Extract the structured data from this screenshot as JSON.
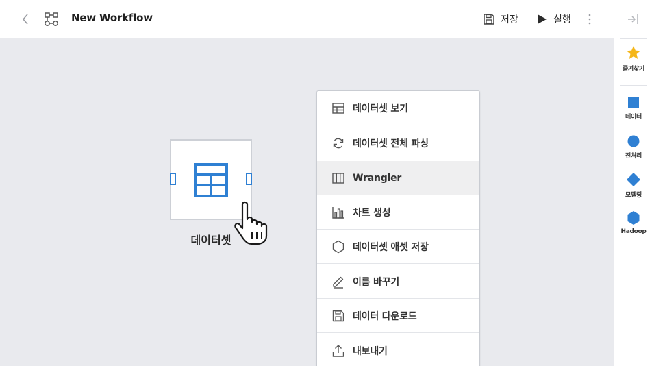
{
  "header": {
    "title": "New Workflow",
    "save_label": "저장",
    "run_label": "실행"
  },
  "canvas": {
    "node": {
      "label": "데이터셋",
      "icon": "table-icon",
      "color": "#2f80d3"
    }
  },
  "context_menu": {
    "items": [
      {
        "label": "데이터셋 보기",
        "icon": "table-icon"
      },
      {
        "label": "데이터셋 전체 파싱",
        "icon": "refresh-icon"
      },
      {
        "label": "Wrangler",
        "icon": "columns-icon",
        "active": true
      },
      {
        "label": "차트 생성",
        "icon": "bar-chart-icon"
      },
      {
        "label": "데이터셋 애셋 저장",
        "icon": "hexagon-icon"
      },
      {
        "label": "이름 바꾸기",
        "icon": "pencil-icon"
      },
      {
        "label": "데이터 다운로드",
        "icon": "save-icon"
      },
      {
        "label": "내보내기",
        "icon": "upload-icon"
      }
    ]
  },
  "right_panel": {
    "favorites": {
      "label": "즐겨찾기",
      "icon": "star-icon",
      "color": "#f5b71a"
    },
    "items": [
      {
        "label": "데이터",
        "icon": "square-icon",
        "color": "#2f80d3"
      },
      {
        "label": "전처리",
        "icon": "circle-icon",
        "color": "#2f80d3"
      },
      {
        "label": "모델링",
        "icon": "diamond-icon",
        "color": "#2f80d3"
      },
      {
        "label": "Hadoop",
        "icon": "hexagon-icon",
        "color": "#2f80d3"
      }
    ]
  }
}
